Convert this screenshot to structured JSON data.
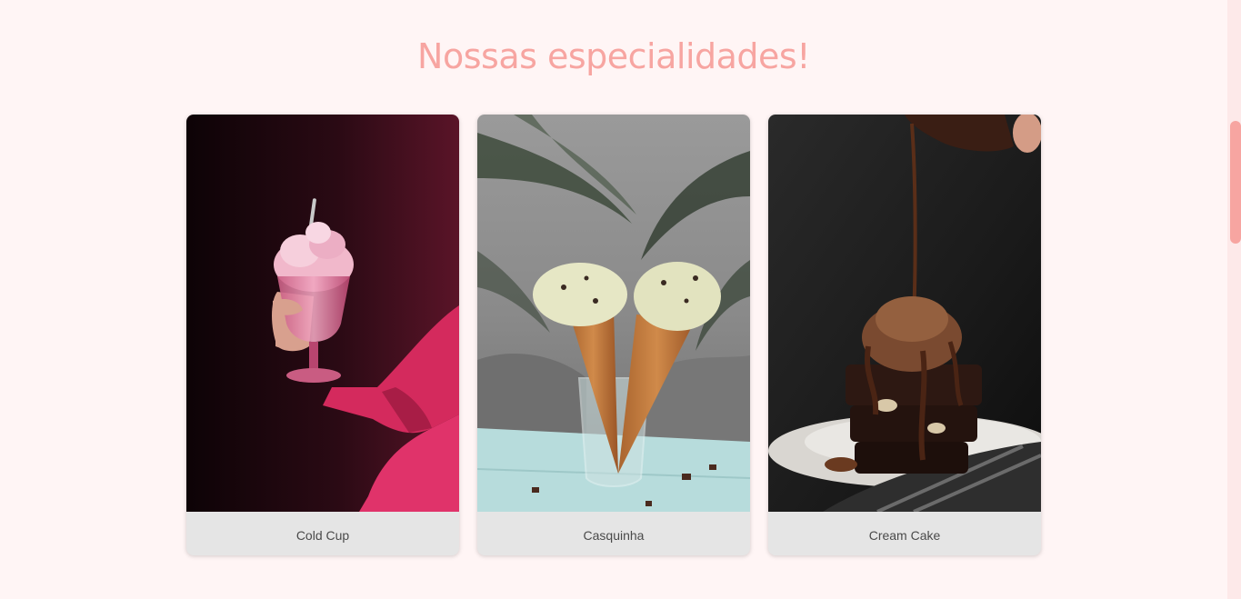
{
  "section": {
    "title": "Nossas especialidades!"
  },
  "cards": [
    {
      "label": "Cold Cup",
      "photo": "cold-cup-photo"
    },
    {
      "label": "Casquinha",
      "photo": "ice-cream-cones-photo"
    },
    {
      "label": "Cream Cake",
      "photo": "chocolate-brownie-photo"
    }
  ],
  "colors": {
    "background": "#fff5f5",
    "title": "#f7a5a1",
    "card_footer": "#e5e5e5",
    "scrollbar_thumb": "#f7a5a1"
  }
}
